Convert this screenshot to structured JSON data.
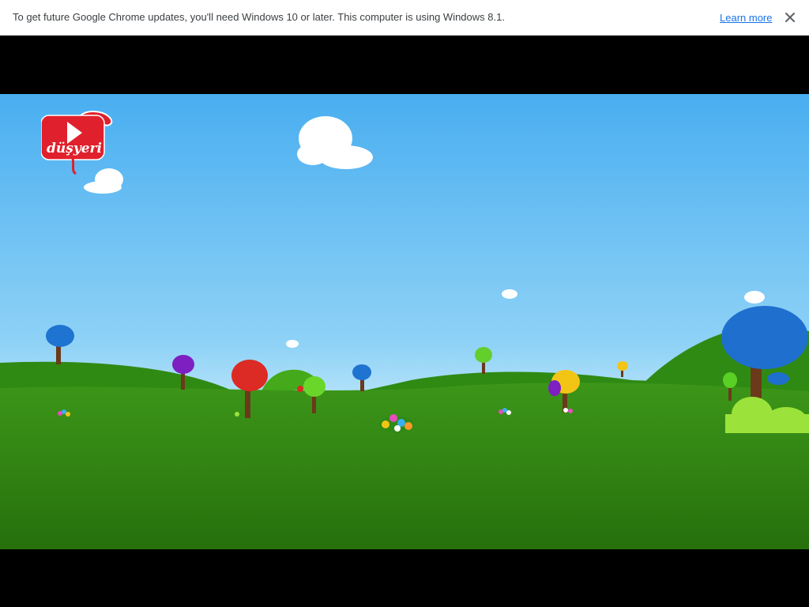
{
  "infobar": {
    "message": "To get future Google Chrome updates, you'll need Windows 10 or later. This computer is using Windows 8.1.",
    "learn_more_label": "Learn more",
    "close_icon": "close-icon"
  },
  "video": {
    "logo_text": "düşyeri",
    "logo_icon": "play-icon"
  },
  "colors": {
    "sky_top": "#4fb2ef",
    "sky_bottom": "#c9ebfb",
    "grass": "#2f7d12",
    "logo_red": "#e0202c"
  }
}
